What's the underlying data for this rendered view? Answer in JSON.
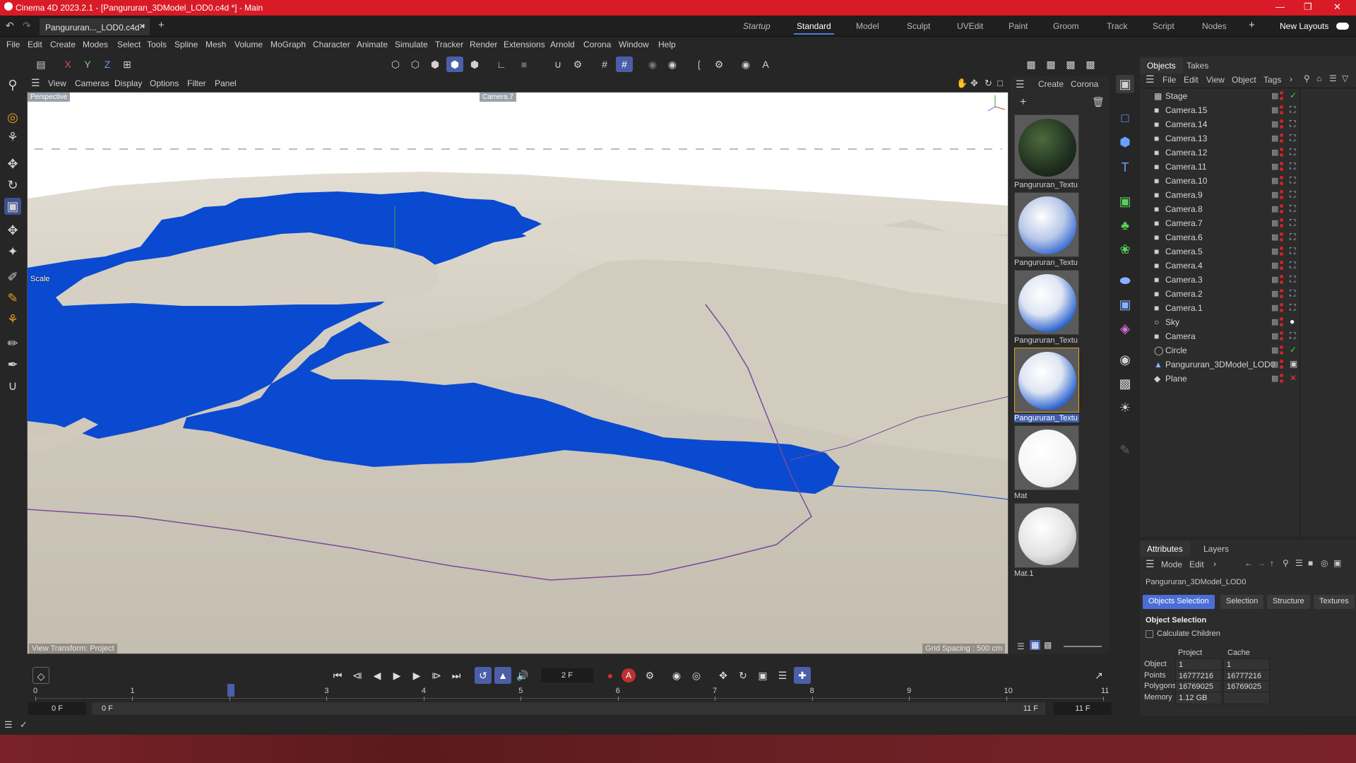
{
  "window": {
    "title": "Cinema 4D 2023.2.1 - [Pangururan_3DModel_LOD0.c4d *] - Main"
  },
  "doc_tab": {
    "label": "Pangururan..._LOD0.c4d *",
    "add_label": "+"
  },
  "layouts": [
    "Startup",
    "Standard",
    "Model",
    "Sculpt",
    "UVEdit",
    "Paint",
    "Groom",
    "Track",
    "Script",
    "Nodes"
  ],
  "new_layouts": "New Layouts",
  "menu": [
    "File",
    "Edit",
    "Create",
    "Modes",
    "Select",
    "Tools",
    "Spline",
    "Mesh",
    "Volume",
    "MoGraph",
    "Character",
    "Animate",
    "Simulate",
    "Tracker",
    "Render",
    "Extensions",
    "Arnold",
    "Corona",
    "Window",
    "Help"
  ],
  "axis_buttons": [
    "X",
    "Y",
    "Z"
  ],
  "viewport_menu": [
    "View",
    "Cameras",
    "Display",
    "Options",
    "Filter",
    "Panel"
  ],
  "viewport": {
    "camera_label": "Perspective",
    "camera_name": "Camera.7",
    "tool_label": "Scale",
    "view_transform": "View Transform: Project",
    "grid_spacing": "Grid Spacing : 500 cm",
    "colors": {
      "water": "#0a4ad0",
      "land": "#cfc9bd",
      "sky": "#ffffff"
    }
  },
  "material_menu": [
    "Create",
    "Corona"
  ],
  "materials": [
    {
      "name": "Pangururan_Textu",
      "style": "green-dark"
    },
    {
      "name": "Pangururan_Textu",
      "style": "blue-white"
    },
    {
      "name": "Pangururan_Textu",
      "style": "blue-white"
    },
    {
      "name": "Pangururan_Textu",
      "style": "blue-white-selected"
    },
    {
      "name": "Mat",
      "style": "white"
    },
    {
      "name": "Mat.1",
      "style": "white-gray"
    }
  ],
  "objects_tabs": [
    "Objects",
    "Takes"
  ],
  "objects_menu": [
    "File",
    "Edit",
    "View",
    "Object",
    "Tags"
  ],
  "objects": [
    {
      "name": "Stage",
      "icon": "stage-icon",
      "tag": "check"
    },
    {
      "name": "Camera.15",
      "icon": "camera-icon",
      "tag": "target"
    },
    {
      "name": "Camera.14",
      "icon": "camera-icon",
      "tag": "target"
    },
    {
      "name": "Camera.13",
      "icon": "camera-icon",
      "tag": "target"
    },
    {
      "name": "Camera.12",
      "icon": "camera-icon",
      "tag": "target"
    },
    {
      "name": "Camera.11",
      "icon": "camera-icon",
      "tag": "target"
    },
    {
      "name": "Camera.10",
      "icon": "camera-icon",
      "tag": "target"
    },
    {
      "name": "Camera.9",
      "icon": "camera-icon",
      "tag": "target"
    },
    {
      "name": "Camera.8",
      "icon": "camera-icon",
      "tag": "target"
    },
    {
      "name": "Camera.7",
      "icon": "camera-icon",
      "tag": "target"
    },
    {
      "name": "Camera.6",
      "icon": "camera-icon",
      "tag": "target"
    },
    {
      "name": "Camera.5",
      "icon": "camera-icon",
      "tag": "target"
    },
    {
      "name": "Camera.4",
      "icon": "camera-icon",
      "tag": "target"
    },
    {
      "name": "Camera.3",
      "icon": "camera-icon",
      "tag": "target"
    },
    {
      "name": "Camera.2",
      "icon": "camera-icon",
      "tag": "target"
    },
    {
      "name": "Camera.1",
      "icon": "camera-icon",
      "tag": "target"
    },
    {
      "name": "Sky",
      "icon": "sky-icon",
      "tag": "sphere"
    },
    {
      "name": "Camera",
      "icon": "camera-icon",
      "tag": "target"
    },
    {
      "name": "Circle",
      "icon": "circle-icon",
      "tag": "check"
    },
    {
      "name": "Pangururan_3DModel_LOD0",
      "icon": "polygon-icon",
      "tag": "materials"
    },
    {
      "name": "Plane",
      "icon": "plane-icon",
      "tag": "cross"
    }
  ],
  "attributes": {
    "tabs": [
      "Attributes",
      "Layers"
    ],
    "menu": [
      "Mode",
      "Edit"
    ],
    "object_name": "Pangururan_3DModel_LOD0",
    "sub_tabs": [
      "Objects Selection",
      "Selection",
      "Structure",
      "Textures"
    ],
    "section": "Object Selection",
    "calc_children": "Calculate Children",
    "col_project": "Project",
    "col_cache": "Cache",
    "rows": [
      {
        "label": "Object",
        "project": "1",
        "cache": "1"
      },
      {
        "label": "Points",
        "project": "16777216",
        "cache": "16777216"
      },
      {
        "label": "Polygons",
        "project": "16769025",
        "cache": "16769025"
      },
      {
        "label": "Memory",
        "project": "1.12 GB",
        "cache": ""
      }
    ]
  },
  "timeline": {
    "current_frame": "2 F",
    "ticks": [
      "0",
      "1",
      "2",
      "3",
      "4",
      "5",
      "6",
      "7",
      "8",
      "9",
      "10",
      "11"
    ],
    "start_a": "0 F",
    "start_b": "0 F",
    "end_a": "11 F",
    "end_b": "11 F"
  }
}
